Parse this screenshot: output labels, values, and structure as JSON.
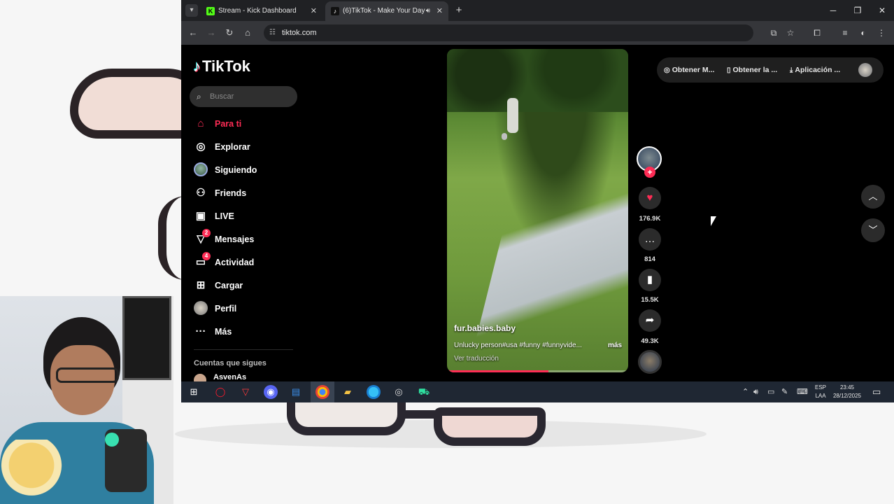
{
  "browser": {
    "tabs": [
      {
        "title": "Stream - Kick Dashboard",
        "favicon_color": "#53fc18"
      },
      {
        "title": "(6)TikTok - Make Your Day",
        "favicon_color": "#111111"
      }
    ],
    "url": "tiktok.com"
  },
  "tiktok": {
    "logo": "TikTok",
    "search_placeholder": "Buscar",
    "nav": [
      {
        "label": "Para ti",
        "icon": "home-icon"
      },
      {
        "label": "Explorar",
        "icon": "compass-icon"
      },
      {
        "label": "Siguiendo",
        "icon": "avatar"
      },
      {
        "label": "Friends",
        "icon": "friends-icon"
      },
      {
        "label": "LIVE",
        "icon": "live-icon"
      },
      {
        "label": "Mensajes",
        "icon": "message-icon",
        "badge": "2"
      },
      {
        "label": "Actividad",
        "icon": "activity-icon",
        "badge": "4"
      },
      {
        "label": "Cargar",
        "icon": "upload-icon"
      },
      {
        "label": "Perfil",
        "icon": "profile-icon"
      },
      {
        "label": "Más",
        "icon": "more-icon"
      }
    ],
    "following_heading": "Cuentas que sigues",
    "following": [
      {
        "name": "AsvenAs"
      }
    ],
    "top_buttons": [
      {
        "label": "Obtener M...",
        "icon": "coin-icon"
      },
      {
        "label": "Obtener la ...",
        "icon": "phone-icon"
      },
      {
        "label": "Aplicación ...",
        "icon": "download-icon"
      }
    ],
    "video": {
      "username": "fur.babies.baby",
      "description": "Unlucky person#usa #funny #funnyvide...",
      "more": "más",
      "translation": "Ver traducción",
      "progress": 0.56
    },
    "actions": {
      "likes": "176.9K",
      "comments": "814",
      "saves": "15.5K",
      "shares": "49.3K"
    },
    "accent": "#fe2c55"
  },
  "taskbar": {
    "lang_line1": "ESP",
    "lang_line2": "LAA",
    "time": "23:45",
    "date": "28/12/2025"
  }
}
